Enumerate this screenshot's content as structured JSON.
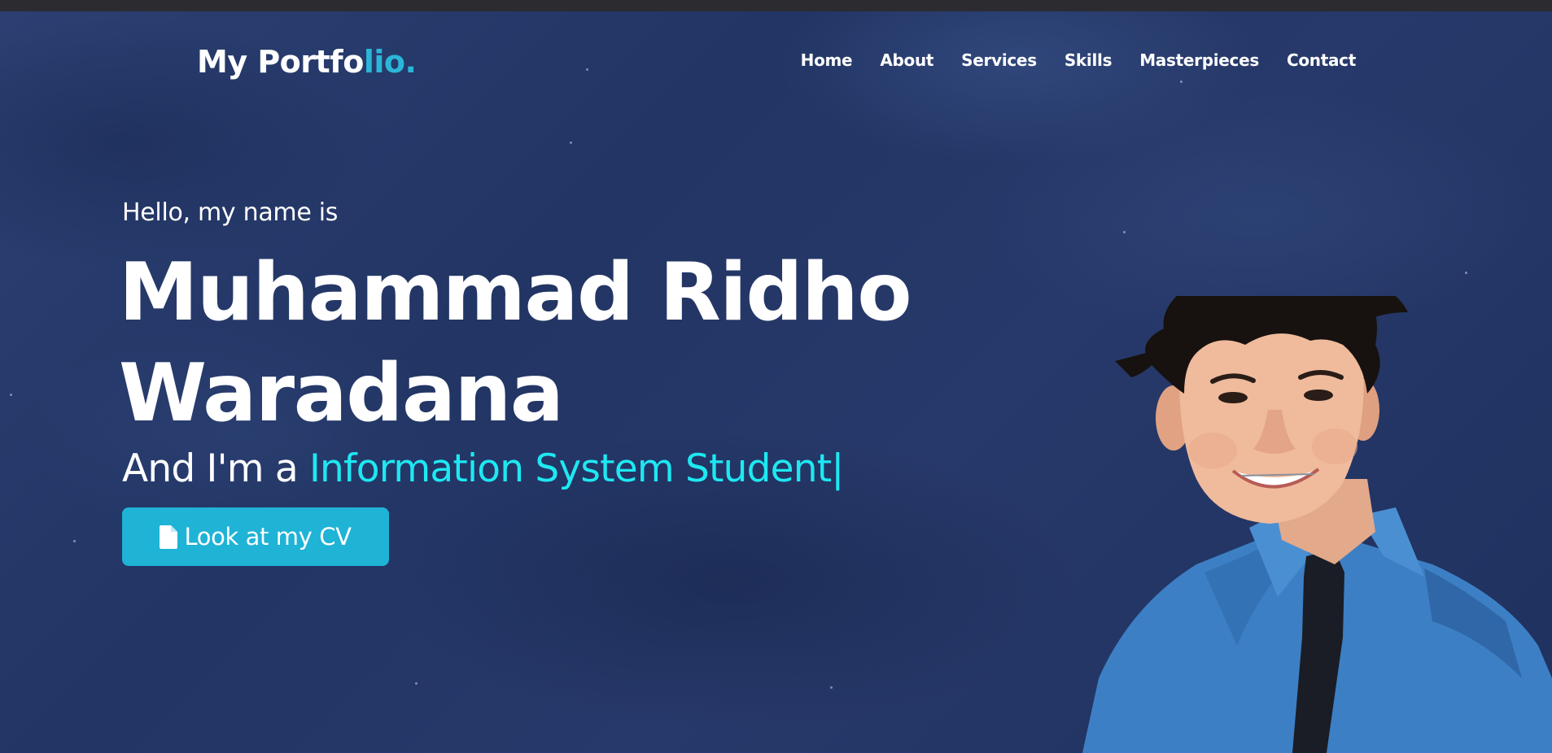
{
  "nav": {
    "logo_main": "My Portfo",
    "logo_accent": "lio.",
    "items": [
      {
        "label": "Home"
      },
      {
        "label": "About"
      },
      {
        "label": "Services"
      },
      {
        "label": "Skills"
      },
      {
        "label": "Masterpieces"
      },
      {
        "label": "Contact"
      }
    ]
  },
  "hero": {
    "greeting": "Hello, my name is",
    "name_line1": "Muhammad Ridho",
    "name_line2": "Waradana",
    "role_prefix": "And I'm a ",
    "role_typed": "Information System Student",
    "cursor": "|",
    "cv_button_label": "Look at my CV",
    "cv_button_icon": "file-icon",
    "portrait_icon": "profile-photo"
  },
  "colors": {
    "background": "#24376a",
    "logo_accent": "#2bb6d9",
    "typed_text": "#1ee8f2",
    "button": "#1fb3d6",
    "text": "#ffffff"
  }
}
